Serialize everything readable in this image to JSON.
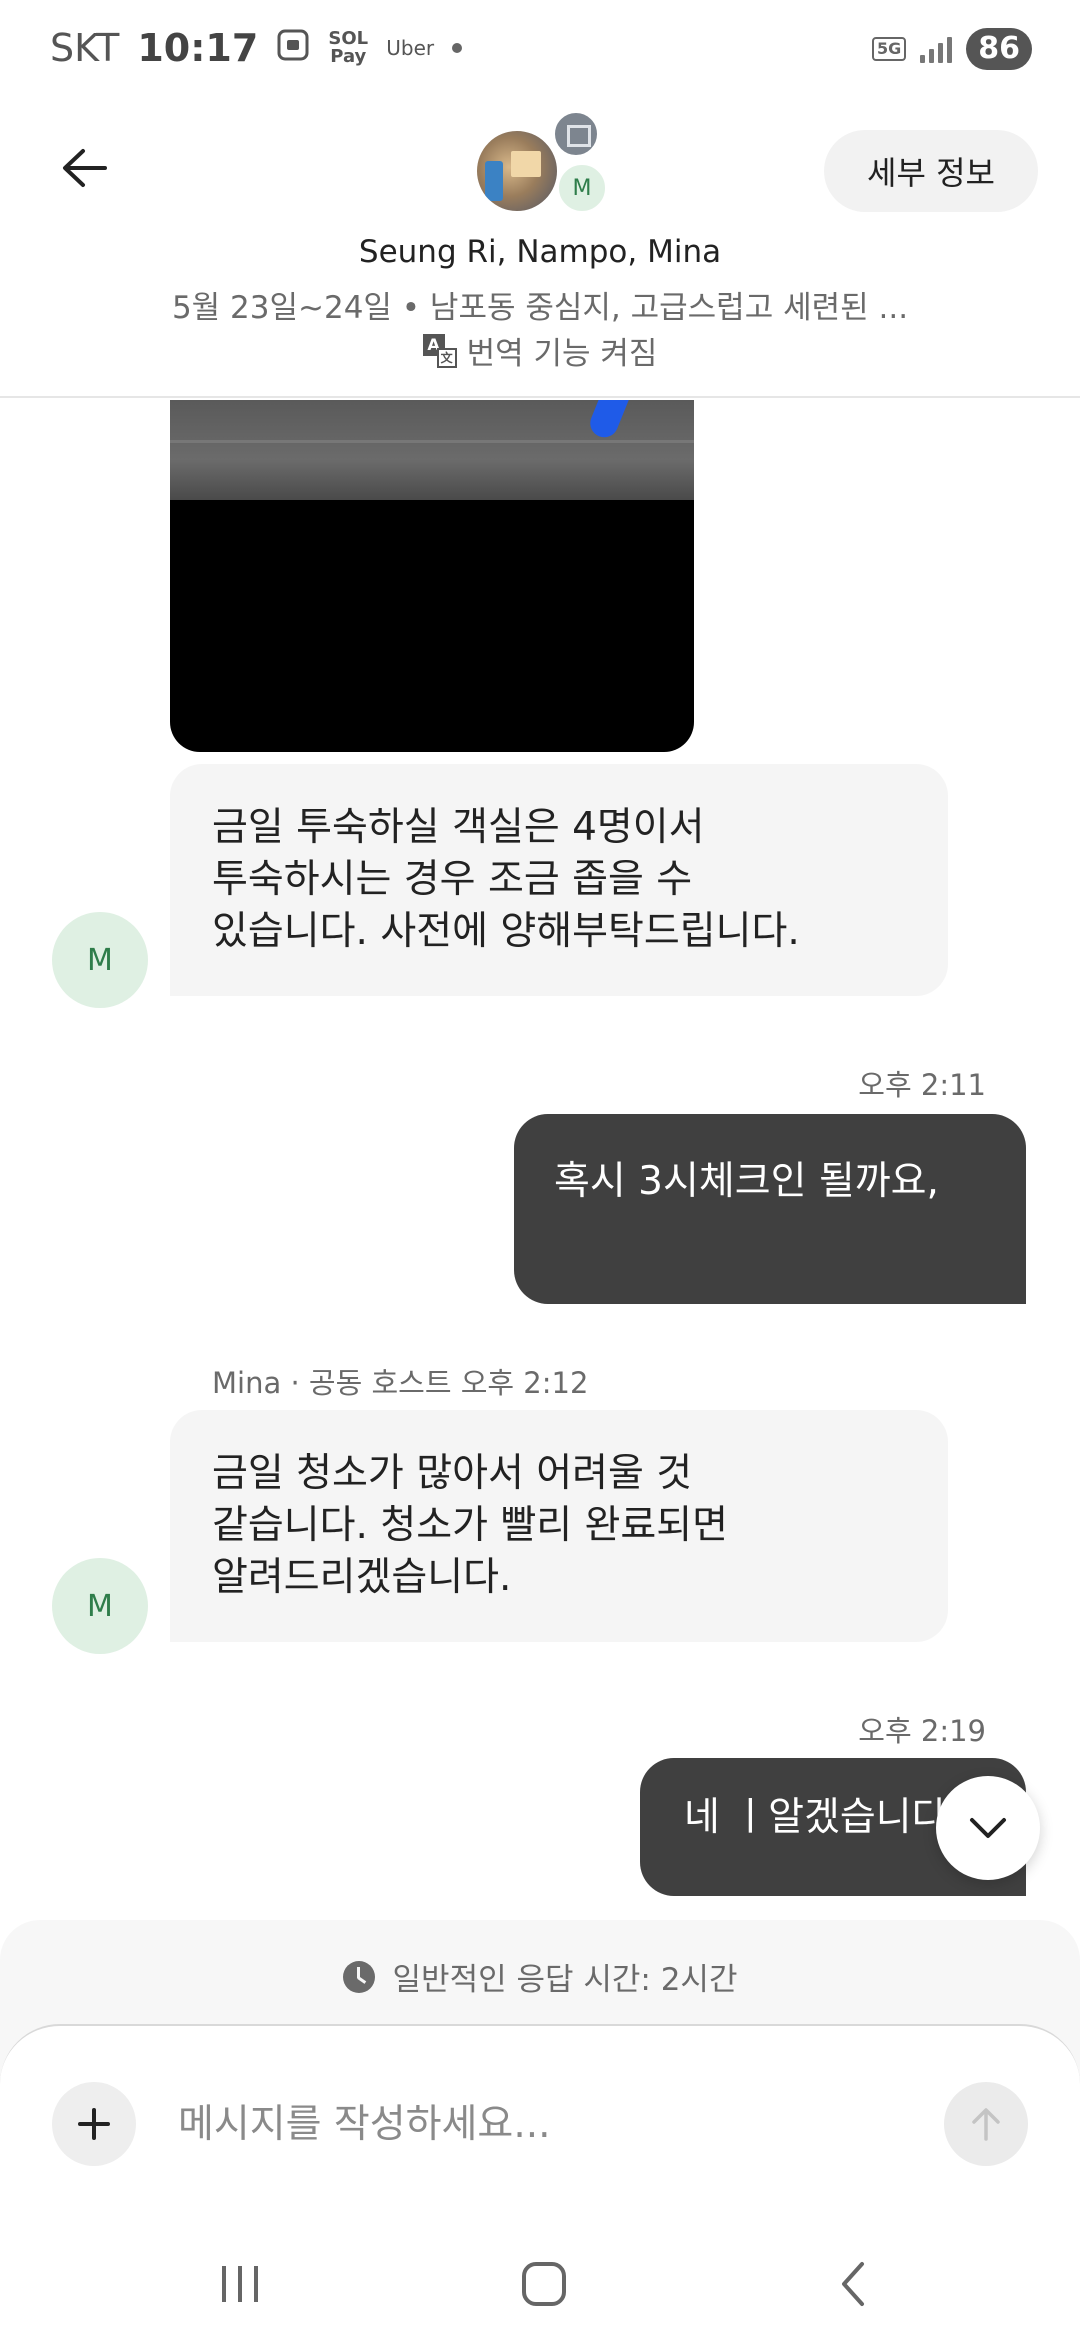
{
  "status_bar": {
    "carrier": "SKT",
    "time": "10:17",
    "sol_pay": "SOL Pay",
    "uber": "Uber",
    "network": "5G",
    "battery": "86"
  },
  "header": {
    "avatar_initial": "M",
    "detail_button": "세부 정보",
    "title": "Seung Ri, Nampo, Mina",
    "subtitle": "5월 23일~24일 • 남포동 중심지, 고급스럽고 세련된 ...",
    "translate_label": "번역 기능 켜짐"
  },
  "messages": {
    "msg1": {
      "avatar": "M",
      "text_line1": "금일 투숙하실 객실은 4명이서",
      "text_line2": "투숙하시는 경우 조금 좁을 수",
      "text_line3": "있습니다. 사전에 양해부탁드립니다."
    },
    "msg2": {
      "time": "오후 2:11",
      "text": "혹시 3시체크인 될까요,"
    },
    "msg3": {
      "meta": "Mina · 공동 호스트  오후 2:12",
      "avatar": "M",
      "text_line1": "금일 청소가 많아서 어려울 것",
      "text_line2": "같습니다. 청소가 빨리 완료되면",
      "text_line3": "알려드리겠습니다."
    },
    "msg4": {
      "time": "오후 2:19",
      "text": "네 ㅣ알겠습니다"
    }
  },
  "composer": {
    "response_time": "일반적인 응답 시간: 2시간",
    "placeholder": "메시지를 작성하세요..."
  },
  "icons": {
    "back": "back-arrow-icon",
    "scroll_down": "chevron-down-icon",
    "plus": "plus-icon",
    "send": "arrow-up-icon",
    "clock": "clock-icon",
    "translate": "translate-icon"
  },
  "colors": {
    "outgoing_bubble": "#404040",
    "incoming_bubble": "#f5f5f5",
    "avatar_bg": "#dff0e3",
    "avatar_text": "#2e7d4a"
  }
}
